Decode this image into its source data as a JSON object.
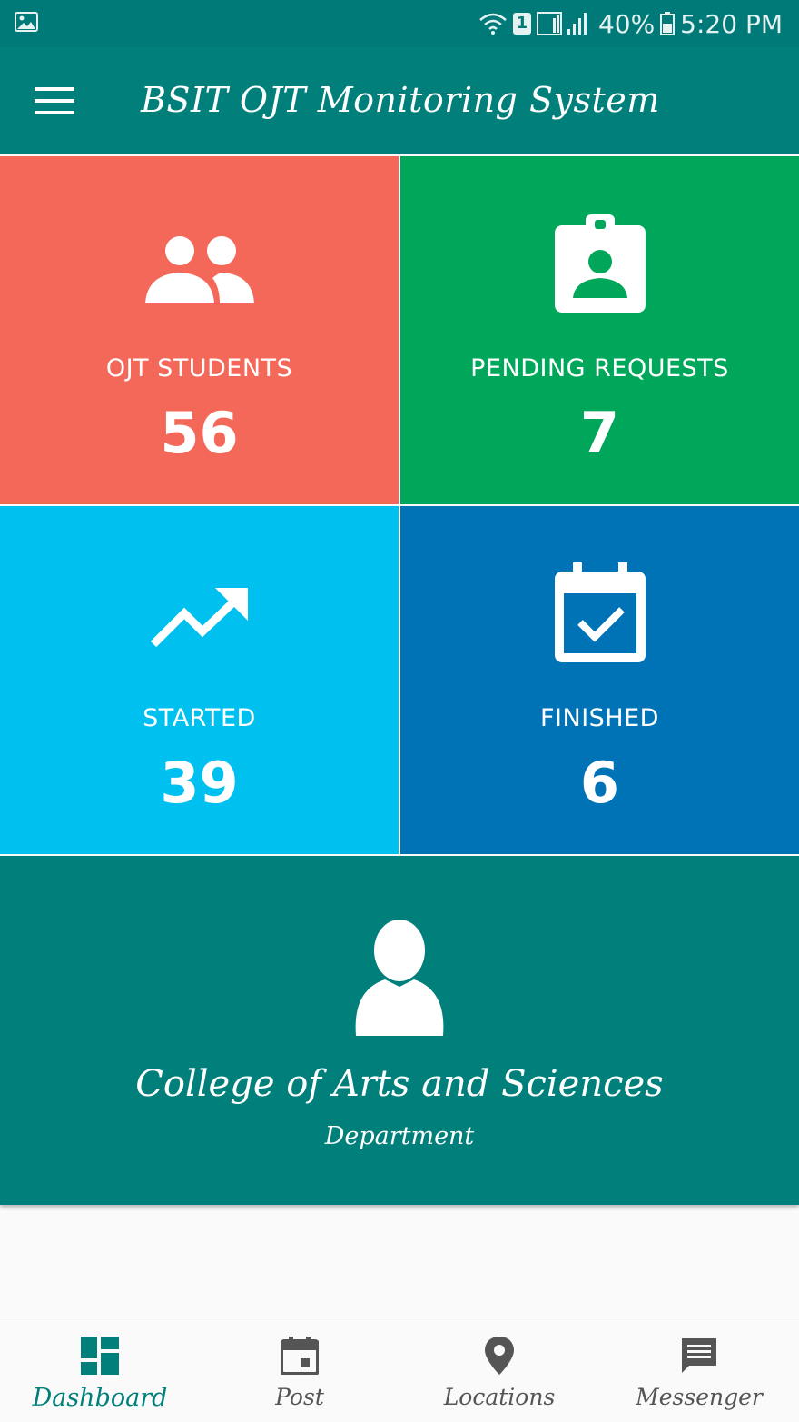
{
  "status_bar": {
    "signal_text": "40%",
    "time": "5:20 PM",
    "sim_label": "1"
  },
  "app_bar": {
    "title": "BSIT OJT Monitoring System"
  },
  "tiles": [
    {
      "label": "OJT STUDENTS",
      "value": "56",
      "icon": "people-icon",
      "color": "#f4685a"
    },
    {
      "label": "PENDING REQUESTS",
      "value": "7",
      "icon": "badge-icon",
      "color": "#00a65a"
    },
    {
      "label": "STARTED",
      "value": "39",
      "icon": "trending-up-icon",
      "color": "#00c0ef"
    },
    {
      "label": "FINISHED",
      "value": "6",
      "icon": "calendar-check-icon",
      "color": "#0073b7"
    }
  ],
  "department": {
    "name": "College of Arts and Sciences",
    "subtitle": "Department",
    "icon": "person-icon"
  },
  "bottom_nav": [
    {
      "label": "Dashboard",
      "icon": "dashboard-icon",
      "active": true
    },
    {
      "label": "Post",
      "icon": "calendar-icon",
      "active": false
    },
    {
      "label": "Locations",
      "icon": "location-pin-icon",
      "active": false
    },
    {
      "label": "Messenger",
      "icon": "message-icon",
      "active": false
    }
  ],
  "colors": {
    "primary": "#007f7b",
    "status_bar": "#007a78",
    "active_nav": "#007f7b"
  }
}
